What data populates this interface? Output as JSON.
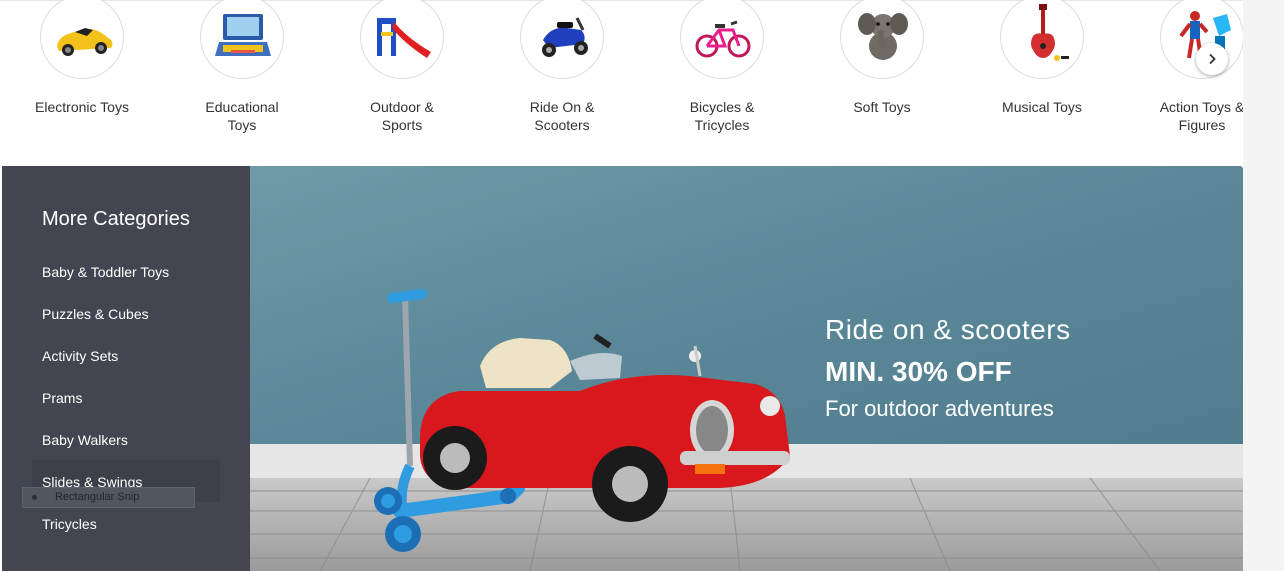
{
  "categories": [
    {
      "label": "Electronic Toys",
      "icon": "toy-car-icon"
    },
    {
      "label": "Educational Toys",
      "icon": "learning-laptop-icon"
    },
    {
      "label": "Outdoor & Sports",
      "icon": "slide-icon"
    },
    {
      "label": "Ride On & Scooters",
      "icon": "ride-on-bike-icon"
    },
    {
      "label": "Bicycles & Tricycles",
      "icon": "bicycle-icon"
    },
    {
      "label": "Soft Toys",
      "icon": "plush-elephant-icon"
    },
    {
      "label": "Musical Toys",
      "icon": "toy-guitar-icon"
    },
    {
      "label": "Action Toys & Figures",
      "icon": "action-figure-icon"
    }
  ],
  "carousel": {
    "next_icon": "chevron-right-icon"
  },
  "sidebar": {
    "heading": "More Categories",
    "items": [
      "Baby & Toddler Toys",
      "Puzzles & Cubes",
      "Activity Sets",
      "Prams",
      "Baby Walkers",
      "Slides & Swings",
      "Tricycles"
    ]
  },
  "snip_tooltip": "Rectangular Snip",
  "banner": {
    "title": "Ride on & scooters",
    "offer": "MIN. 30% OFF",
    "tagline": "For outdoor adventures"
  },
  "colors": {
    "sidebar_bg": "#434550",
    "banner_wall": "#5a8898",
    "car_red": "#d8181c",
    "scooter_blue": "#2f9be0"
  }
}
